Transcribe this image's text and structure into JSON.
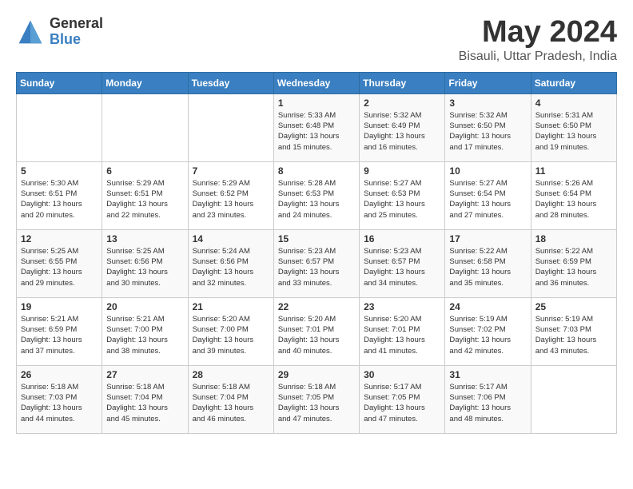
{
  "logo": {
    "general": "General",
    "blue": "Blue"
  },
  "title": "May 2024",
  "location": "Bisauli, Uttar Pradesh, India",
  "weekdays": [
    "Sunday",
    "Monday",
    "Tuesday",
    "Wednesday",
    "Thursday",
    "Friday",
    "Saturday"
  ],
  "weeks": [
    [
      {
        "day": "",
        "info": ""
      },
      {
        "day": "",
        "info": ""
      },
      {
        "day": "",
        "info": ""
      },
      {
        "day": "1",
        "info": "Sunrise: 5:33 AM\nSunset: 6:48 PM\nDaylight: 13 hours\nand 15 minutes."
      },
      {
        "day": "2",
        "info": "Sunrise: 5:32 AM\nSunset: 6:49 PM\nDaylight: 13 hours\nand 16 minutes."
      },
      {
        "day": "3",
        "info": "Sunrise: 5:32 AM\nSunset: 6:50 PM\nDaylight: 13 hours\nand 17 minutes."
      },
      {
        "day": "4",
        "info": "Sunrise: 5:31 AM\nSunset: 6:50 PM\nDaylight: 13 hours\nand 19 minutes."
      }
    ],
    [
      {
        "day": "5",
        "info": "Sunrise: 5:30 AM\nSunset: 6:51 PM\nDaylight: 13 hours\nand 20 minutes."
      },
      {
        "day": "6",
        "info": "Sunrise: 5:29 AM\nSunset: 6:51 PM\nDaylight: 13 hours\nand 22 minutes."
      },
      {
        "day": "7",
        "info": "Sunrise: 5:29 AM\nSunset: 6:52 PM\nDaylight: 13 hours\nand 23 minutes."
      },
      {
        "day": "8",
        "info": "Sunrise: 5:28 AM\nSunset: 6:53 PM\nDaylight: 13 hours\nand 24 minutes."
      },
      {
        "day": "9",
        "info": "Sunrise: 5:27 AM\nSunset: 6:53 PM\nDaylight: 13 hours\nand 25 minutes."
      },
      {
        "day": "10",
        "info": "Sunrise: 5:27 AM\nSunset: 6:54 PM\nDaylight: 13 hours\nand 27 minutes."
      },
      {
        "day": "11",
        "info": "Sunrise: 5:26 AM\nSunset: 6:54 PM\nDaylight: 13 hours\nand 28 minutes."
      }
    ],
    [
      {
        "day": "12",
        "info": "Sunrise: 5:25 AM\nSunset: 6:55 PM\nDaylight: 13 hours\nand 29 minutes."
      },
      {
        "day": "13",
        "info": "Sunrise: 5:25 AM\nSunset: 6:56 PM\nDaylight: 13 hours\nand 30 minutes."
      },
      {
        "day": "14",
        "info": "Sunrise: 5:24 AM\nSunset: 6:56 PM\nDaylight: 13 hours\nand 32 minutes."
      },
      {
        "day": "15",
        "info": "Sunrise: 5:23 AM\nSunset: 6:57 PM\nDaylight: 13 hours\nand 33 minutes."
      },
      {
        "day": "16",
        "info": "Sunrise: 5:23 AM\nSunset: 6:57 PM\nDaylight: 13 hours\nand 34 minutes."
      },
      {
        "day": "17",
        "info": "Sunrise: 5:22 AM\nSunset: 6:58 PM\nDaylight: 13 hours\nand 35 minutes."
      },
      {
        "day": "18",
        "info": "Sunrise: 5:22 AM\nSunset: 6:59 PM\nDaylight: 13 hours\nand 36 minutes."
      }
    ],
    [
      {
        "day": "19",
        "info": "Sunrise: 5:21 AM\nSunset: 6:59 PM\nDaylight: 13 hours\nand 37 minutes."
      },
      {
        "day": "20",
        "info": "Sunrise: 5:21 AM\nSunset: 7:00 PM\nDaylight: 13 hours\nand 38 minutes."
      },
      {
        "day": "21",
        "info": "Sunrise: 5:20 AM\nSunset: 7:00 PM\nDaylight: 13 hours\nand 39 minutes."
      },
      {
        "day": "22",
        "info": "Sunrise: 5:20 AM\nSunset: 7:01 PM\nDaylight: 13 hours\nand 40 minutes."
      },
      {
        "day": "23",
        "info": "Sunrise: 5:20 AM\nSunset: 7:01 PM\nDaylight: 13 hours\nand 41 minutes."
      },
      {
        "day": "24",
        "info": "Sunrise: 5:19 AM\nSunset: 7:02 PM\nDaylight: 13 hours\nand 42 minutes."
      },
      {
        "day": "25",
        "info": "Sunrise: 5:19 AM\nSunset: 7:03 PM\nDaylight: 13 hours\nand 43 minutes."
      }
    ],
    [
      {
        "day": "26",
        "info": "Sunrise: 5:18 AM\nSunset: 7:03 PM\nDaylight: 13 hours\nand 44 minutes."
      },
      {
        "day": "27",
        "info": "Sunrise: 5:18 AM\nSunset: 7:04 PM\nDaylight: 13 hours\nand 45 minutes."
      },
      {
        "day": "28",
        "info": "Sunrise: 5:18 AM\nSunset: 7:04 PM\nDaylight: 13 hours\nand 46 minutes."
      },
      {
        "day": "29",
        "info": "Sunrise: 5:18 AM\nSunset: 7:05 PM\nDaylight: 13 hours\nand 47 minutes."
      },
      {
        "day": "30",
        "info": "Sunrise: 5:17 AM\nSunset: 7:05 PM\nDaylight: 13 hours\nand 47 minutes."
      },
      {
        "day": "31",
        "info": "Sunrise: 5:17 AM\nSunset: 7:06 PM\nDaylight: 13 hours\nand 48 minutes."
      },
      {
        "day": "",
        "info": ""
      }
    ]
  ]
}
